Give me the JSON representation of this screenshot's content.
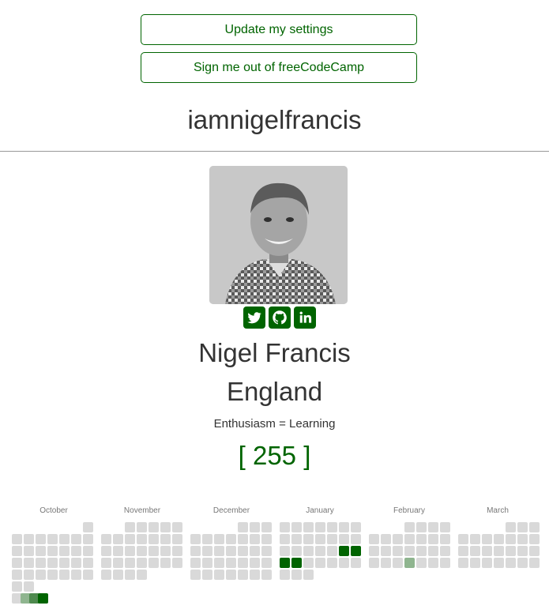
{
  "buttons": {
    "settings_label": "Update my settings",
    "signout_label": "Sign me out of freeCodeCamp"
  },
  "profile": {
    "username": "iamnigelfrancis",
    "name": "Nigel Francis",
    "location": "England",
    "bio": "Enthusiasm = Learning",
    "points": "[ 255 ]",
    "socials": [
      "twitter-icon",
      "github-icon",
      "linkedin-icon"
    ]
  },
  "heatmap": {
    "months": [
      "October",
      "November",
      "December",
      "January",
      "February",
      "March"
    ],
    "colors": {
      "empty": "#d9d9d9",
      "low": "#8fb58f",
      "medium": "#4e8a4e",
      "high": "#006400"
    }
  },
  "theme": {
    "accent": "#006400"
  }
}
